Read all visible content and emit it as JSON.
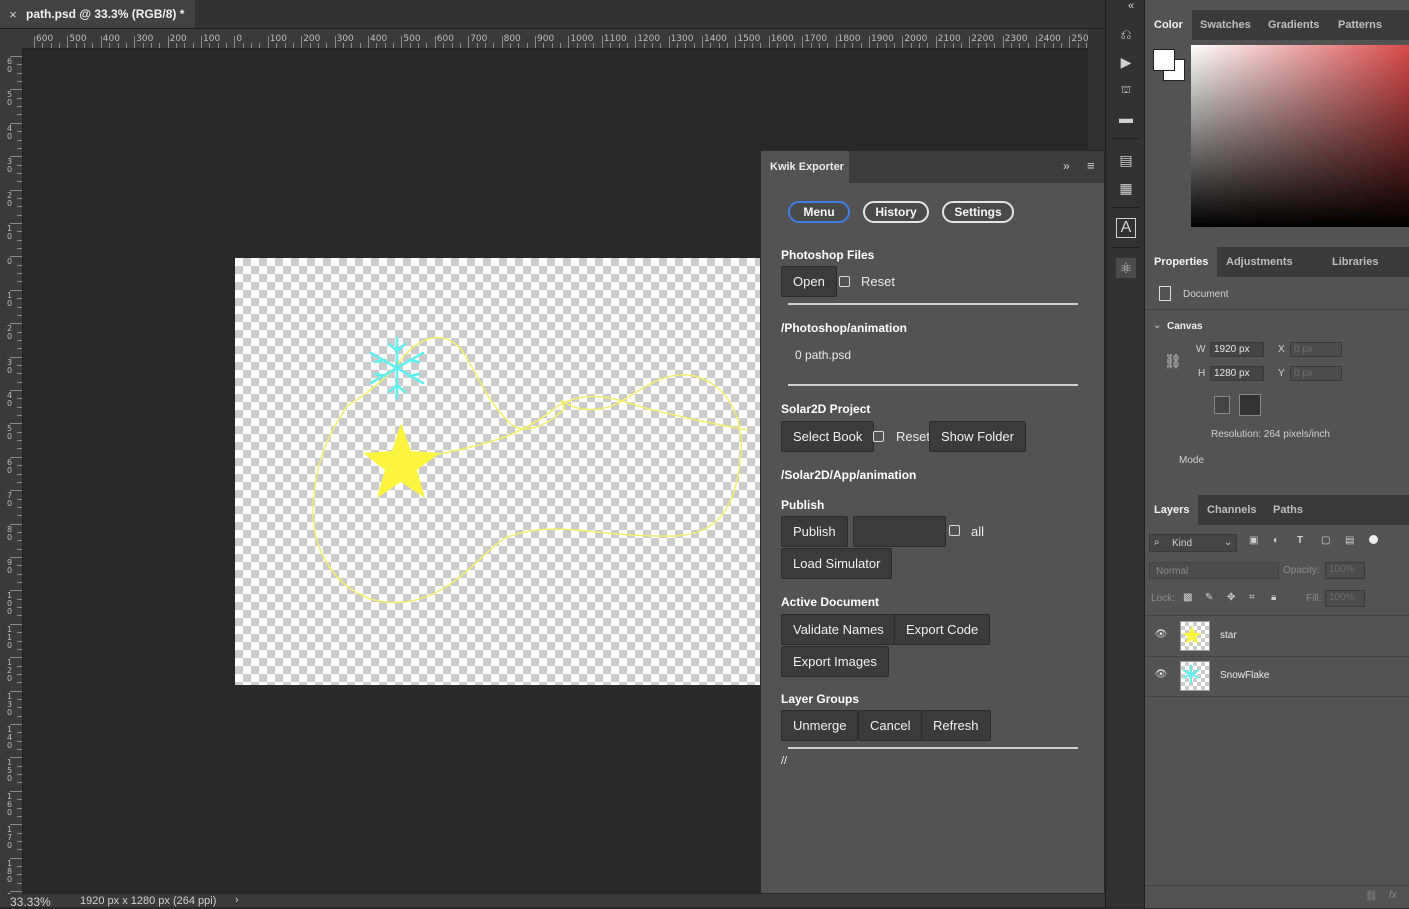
{
  "document_tab": {
    "close_glyph": "×",
    "title": "path.psd @ 33.3% (RGB/8) *"
  },
  "ruler": {
    "top_labels": [
      "600",
      "500",
      "400",
      "300",
      "200",
      "100",
      "0",
      "100",
      "200",
      "300",
      "400",
      "500",
      "600",
      "700",
      "800",
      "900",
      "1000",
      "1100",
      "1200",
      "1300",
      "1400",
      "1500",
      "1600",
      "1700",
      "1800",
      "1900",
      "2000",
      "2100",
      "2200",
      "2300",
      "2400",
      "2500"
    ],
    "left_labels": [
      "60",
      "50",
      "40",
      "30",
      "20",
      "10",
      "0",
      "10",
      "20",
      "30",
      "40",
      "50",
      "60",
      "70",
      "80",
      "90",
      "100",
      "110",
      "120",
      "130",
      "140",
      "150",
      "160",
      "170",
      "180",
      "190"
    ]
  },
  "status": {
    "zoom": "33.33%",
    "doc_info": "1920 px x 1280 px (264 ppi)",
    "arrow": "›"
  },
  "kwik": {
    "tab_title": "Kwik Exporter",
    "collapse_glyph": "»",
    "menu_glyph": "≡",
    "nav": {
      "menu": "Menu",
      "history": "History",
      "settings": "Settings"
    },
    "photoshop_files": {
      "heading": "Photoshop Files",
      "open": "Open",
      "reset": "Reset"
    },
    "ps_path": {
      "heading": "/Photoshop/animation",
      "file": "0 path.psd"
    },
    "solar_project": {
      "heading": "Solar2D Project",
      "select_book": "Select Book",
      "reset": "Reset",
      "show_folder": "Show Folder"
    },
    "solar_path": {
      "heading": "/Solar2D/App/animation"
    },
    "publish": {
      "heading": "Publish",
      "publish": "Publish",
      "all": "all",
      "load_simulator": "Load Simulator"
    },
    "active_document": {
      "heading": "Active Document",
      "validate_names": "Validate Names",
      "export_code": "Export Code",
      "export_images": "Export Images"
    },
    "layer_groups": {
      "heading": "Layer Groups",
      "unmerge": "Unmerge",
      "cancel": "Cancel",
      "refresh": "Refresh"
    },
    "footer": "//"
  },
  "color_panel": {
    "tabs": [
      "Color",
      "Swatches",
      "Gradients",
      "Patterns"
    ],
    "accent": "#d94a4a"
  },
  "properties_panel": {
    "tabs": [
      "Properties",
      "Adjustments",
      "Libraries"
    ],
    "doc_label": "Document",
    "canvas_heading": "Canvas",
    "w_label": "W",
    "w_value": "1920 px",
    "h_label": "H",
    "h_value": "1280 px",
    "x_label": "X",
    "x_value": "0 px",
    "y_label": "Y",
    "y_value": "0 px",
    "resolution": "Resolution: 264 pixels/inch",
    "mode": "Mode"
  },
  "layers_panel": {
    "tabs": [
      "Layers",
      "Channels",
      "Paths"
    ],
    "kind": "Kind",
    "blend": "Normal",
    "opacity_label": "Opacity:",
    "opacity_value": "100%",
    "lock_label": "Lock:",
    "fill_label": "Fill:",
    "fill_value": "100%",
    "layers": [
      {
        "name": "star"
      },
      {
        "name": "SnowFlake"
      }
    ]
  }
}
